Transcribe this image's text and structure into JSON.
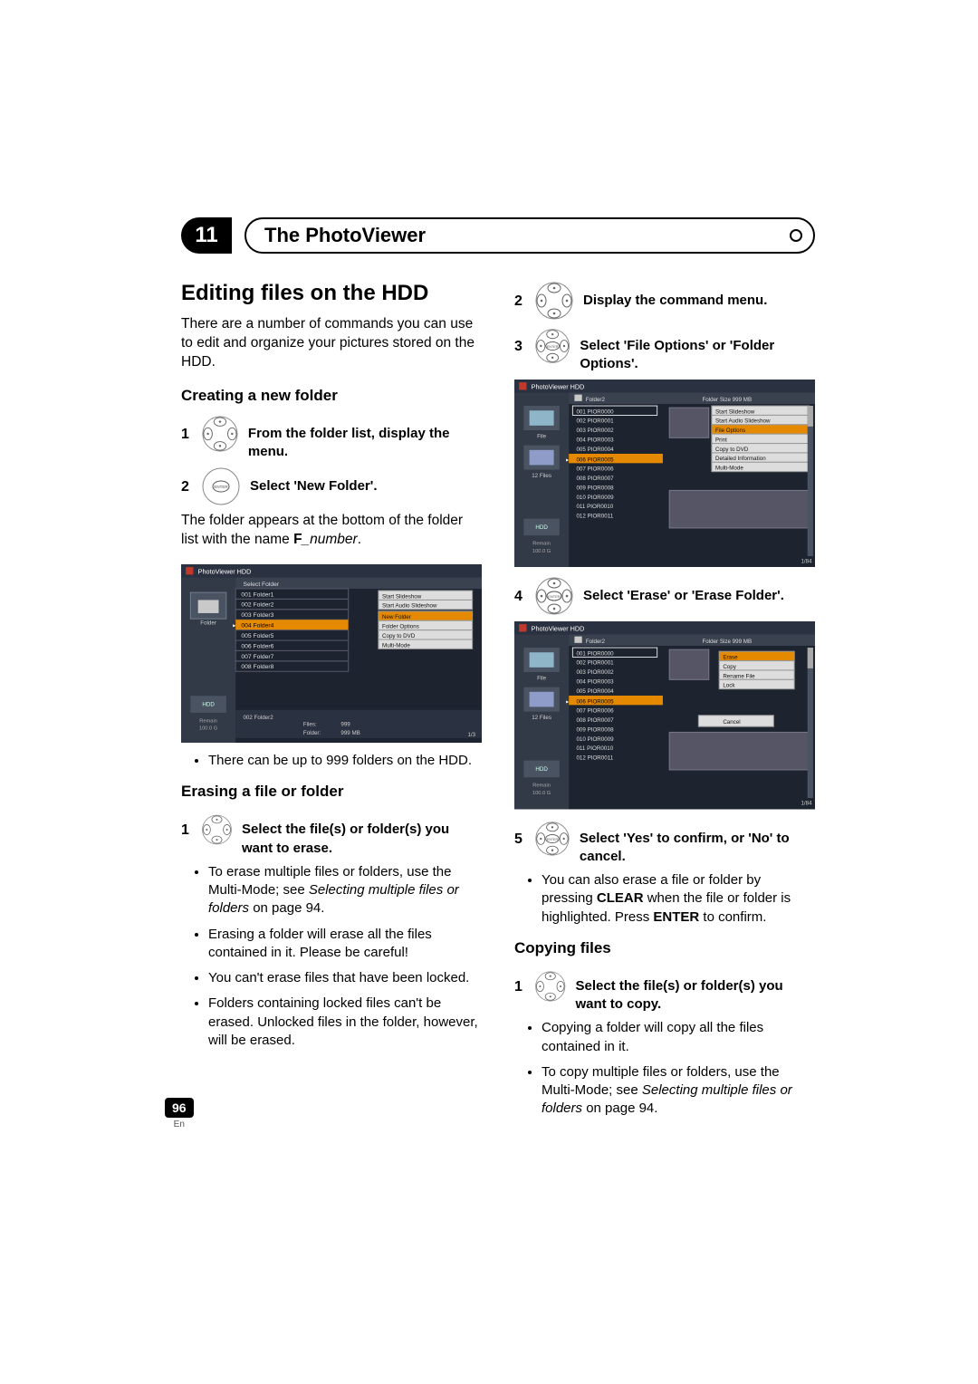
{
  "chapter": {
    "number": "11",
    "title": "The PhotoViewer"
  },
  "section_title": "Editing files on the HDD",
  "intro": "There are a number of commands you can use to edit and organize your pictures stored on the HDD.",
  "create": {
    "heading": "Creating a new folder",
    "step1_num": "1",
    "step1": "From the folder list, display the menu.",
    "step2_num": "2",
    "step2": "Select 'New Folder'.",
    "after": "The folder appears at the bottom of the folder list with the name ",
    "after_bold": "F",
    "after_italic": "_number",
    "after_period": ".",
    "bullet1": "There can be up to 999 folders on the HDD."
  },
  "erase": {
    "heading": "Erasing a file or folder",
    "step1_num": "1",
    "step1": "Select the file(s) or folder(s) you want to erase.",
    "b1a": "To erase multiple files or folders, use the Multi-Mode; see ",
    "b1i": "Selecting multiple files or folders",
    "b1b": " on page 94.",
    "b2": "Erasing a folder will erase all the files contained in it. Please be careful!",
    "b3": "You can't erase files that have been locked.",
    "b4": "Folders containing locked files can't be erased. Unlocked files in the folder, however, will be erased."
  },
  "right": {
    "step2_num": "2",
    "step2": "Display the command menu.",
    "step3_num": "3",
    "step3": "Select 'File Options' or 'Folder Options'.",
    "step4_num": "4",
    "step4": "Select 'Erase' or 'Erase Folder'.",
    "step5_num": "5",
    "step5": "Select 'Yes' to confirm, or 'No' to cancel.",
    "b1a": "You can also erase a file or folder by pressing ",
    "b1bold1": "CLEAR",
    "b1b": " when the file or folder is highlighted. Press ",
    "b1bold2": "ENTER",
    "b1c": " to confirm."
  },
  "copy": {
    "heading": "Copying files",
    "step1_num": "1",
    "step1": "Select the file(s) or folder(s) you want to copy.",
    "b1": "Copying a folder will copy all the files contained in it.",
    "b2a": "To copy multiple files or folders, use the Multi-Mode; see ",
    "b2i": "Selecting multiple files or folders",
    "b2b": " on page 94."
  },
  "thumb1": {
    "title": "PhotoViewer  HDD",
    "selectFolder": "Select Folder",
    "side_label": "Folder",
    "folders": [
      "001  Folder1",
      "002  Folder2",
      "003  Folder3",
      "004  Folder4",
      "005  Folder5",
      "006  Folder6",
      "007  Folder7",
      "008  Folder8"
    ],
    "menu": [
      "Start Slideshow",
      "Start Audio Slideshow",
      "New Folder",
      "Folder Options",
      "Copy to DVD",
      "Multi-Mode"
    ],
    "hdd": "HDD",
    "remain": "Remain",
    "remain_v": "100.0 G",
    "info_l": "002  Folder2",
    "info_files": "Files:",
    "info_files_v": "999",
    "info_folder": "Folder:",
    "info_folder_v": "999 MB",
    "pg": "1/3"
  },
  "thumb2": {
    "title": "PhotoViewer  HDD",
    "folder2": "Folder2",
    "size": "Folder Size 999 MB",
    "side_label": "File",
    "side_count": "12 Files",
    "items": [
      "001  PIOR0000",
      "002  PIOR0001",
      "003  PIOR0002",
      "004  PIOR0003",
      "005  PIOR0004",
      "006  PIOR0005",
      "007  PIOR0006",
      "008  PIOR0007",
      "009  PIOR0008",
      "010  PIOR0009",
      "011  PIOR0010",
      "012  PIOR0011"
    ],
    "menu": [
      "Start Slideshow",
      "Start Audio Slideshow",
      "File Options",
      "Print",
      "Copy to DVD",
      "Detailed Information",
      "Multi-Mode"
    ],
    "hdd": "HDD",
    "remain": "Remain",
    "remain_v": "100.0 G",
    "pg": "1/84"
  },
  "thumb3": {
    "title": "PhotoViewer  HDD",
    "folder2": "Folder2",
    "size": "Folder Size 999 MB",
    "side_label": "File",
    "side_count": "12 Files",
    "items": [
      "001  PIOR0000",
      "002  PIOR0001",
      "003  PIOR0002",
      "004  PIOR0003",
      "005  PIOR0004",
      "006  PIOR0005",
      "007  PIOR0006",
      "008  PIOR0007",
      "009  PIOR0008",
      "010  PIOR0009",
      "011  PIOR0010",
      "012  PIOR0011"
    ],
    "menu": [
      "Erase",
      "Copy",
      "Rename File",
      "Lock"
    ],
    "cancel": "Cancel",
    "hdd": "HDD",
    "remain": "Remain",
    "remain_v": "100.0 G",
    "pg": "1/84"
  },
  "footer": {
    "page": "96",
    "lang": "En"
  }
}
